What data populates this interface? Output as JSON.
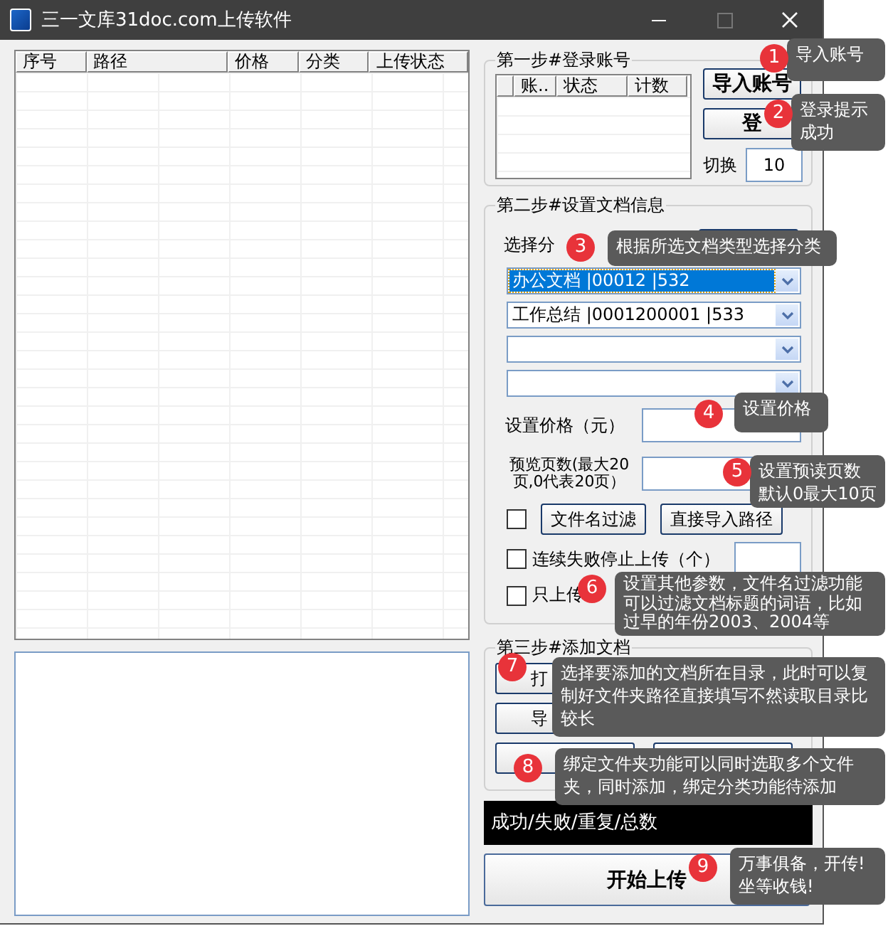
{
  "window": {
    "title": "三一文库31doc.com上传软件"
  },
  "file_table": {
    "columns": [
      "序号",
      "路径",
      "价格",
      "分类",
      "上传状态"
    ]
  },
  "step1": {
    "title": "第一步#登录账号",
    "account_columns": [
      "",
      "账..",
      "状态",
      "计数"
    ],
    "buttons": [
      "导入账号",
      "登"
    ],
    "switch_label": "切换",
    "switch_value": "10"
  },
  "step2": {
    "title": "第二步#设置文档信息",
    "category_label": "选择分",
    "categories": [
      {
        "value": "办公文档 |00012 |532",
        "selected": true
      },
      {
        "value": "工作总结 |0001200001 |533",
        "selected": false
      },
      {
        "selected": false
      },
      {
        "selected": false
      }
    ],
    "price_label": "设置价格（元）",
    "preview_label": "预览页数(最大20页,0代表20页）",
    "options": [
      {
        "kind": "checkbox-buttons",
        "checked": false,
        "buttons": [
          "文件名过滤",
          "直接导入路径"
        ]
      },
      {
        "kind": "checkbox-field",
        "checked": false,
        "label": "连续失败停止上传（个）"
      },
      {
        "kind": "checkbox",
        "checked": false,
        "label": "只上传"
      }
    ]
  },
  "step3": {
    "title": "第三步#添加文档",
    "button_1": "打",
    "button_3": "导"
  },
  "status": "成功/失败/重复/总数",
  "start_button": "开始上传",
  "callouts": [
    {
      "number": "1",
      "text": "导入账号"
    },
    {
      "number": "2",
      "text": "登录提示成功"
    },
    {
      "number": "3",
      "text": "根据所选文档类型选择分类"
    },
    {
      "number": "4",
      "text": "设置价格"
    },
    {
      "number": "5",
      "text": "设置预读页数默认0最大10页"
    },
    {
      "number": "6",
      "text": "设置其他参数，文件名过滤功能可以过滤文档标题的词语，比如过早的年份2003、2004等"
    },
    {
      "number": "7",
      "text": "选择要添加的文档所在目录，此时可以复制好文件夹路径直接填写不然读取目录比较长"
    },
    {
      "number": "8",
      "text": "绑定文件夹功能可以同时选取多个文件夹，同时添加，绑定分类功能待添加"
    },
    {
      "number": "9",
      "text": "万事俱备，开传!坐等收钱!"
    }
  ]
}
